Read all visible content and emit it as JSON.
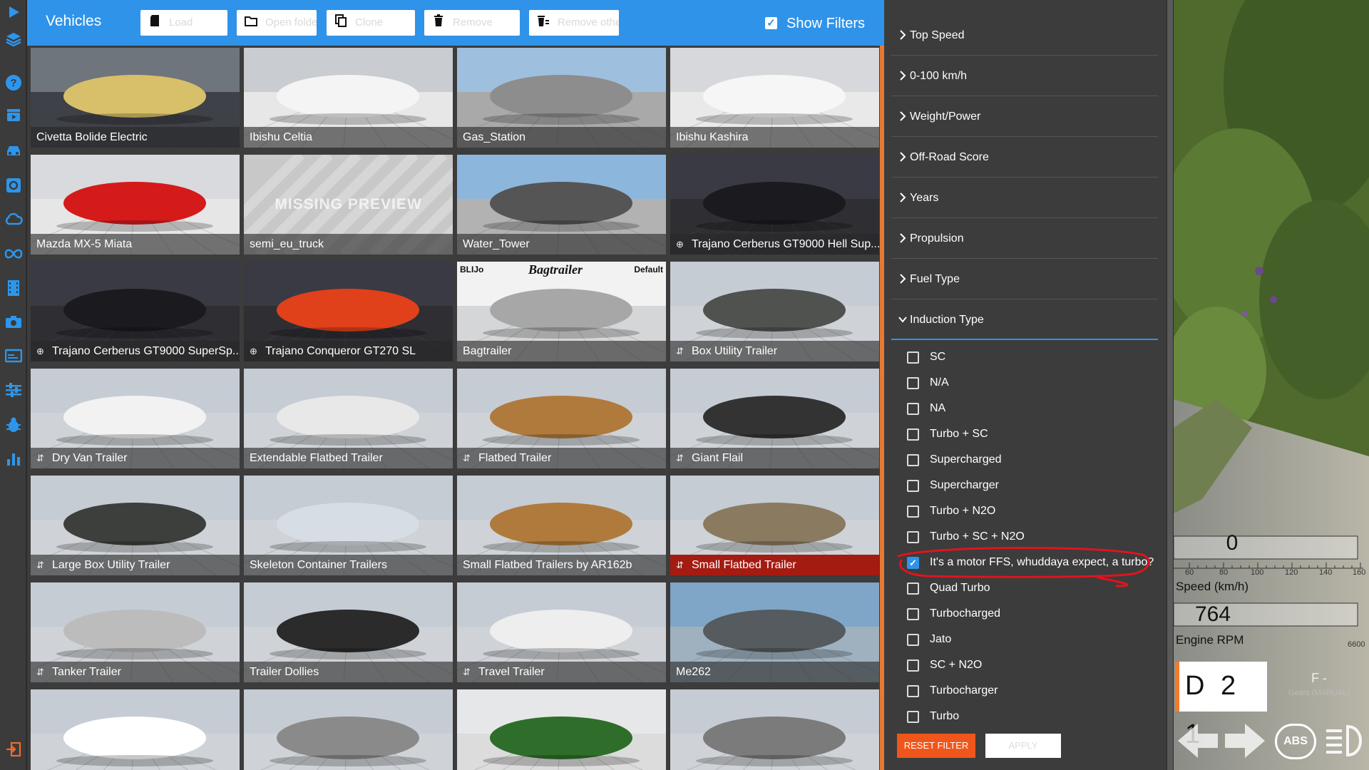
{
  "rail": {
    "icons": [
      "play-icon",
      "layers-icon",
      "help-icon",
      "clapper-icon",
      "car-icon",
      "gear-box-icon",
      "cloud-icon",
      "infinity-icon",
      "film-icon",
      "camera-icon",
      "screen-icon",
      "sliders-icon",
      "bug-icon",
      "bar-chart-icon",
      "exit-icon"
    ]
  },
  "header": {
    "title": "Vehicles",
    "buttons": [
      {
        "label": "Load",
        "icon": "sd-card-icon"
      },
      {
        "label": "Open folder",
        "icon": "folder-icon"
      },
      {
        "label": "Clone",
        "icon": "copy-icon"
      },
      {
        "label": "Remove",
        "icon": "trash-icon"
      },
      {
        "label": "Remove others",
        "icon": "trash-list-icon"
      }
    ],
    "show_filters": {
      "label": "Show Filters",
      "checked": true
    }
  },
  "vehicles": [
    {
      "name": "Civetta Bolide Electric",
      "icon": "",
      "selected": false
    },
    {
      "name": "Ibishu Celtia",
      "icon": "",
      "selected": false
    },
    {
      "name": "Gas_Station",
      "icon": "",
      "selected": false
    },
    {
      "name": "Ibishu Kashira",
      "icon": "",
      "selected": false
    },
    {
      "name": "Mazda MX-5 Miata",
      "icon": "",
      "selected": false
    },
    {
      "name": "semi_eu_truck",
      "icon": "",
      "selected": false,
      "placeholder": "MISSING PREVIEW"
    },
    {
      "name": "Water_Tower",
      "icon": "",
      "selected": false
    },
    {
      "name": "Trajano Cerberus GT9000 Hell Sup...",
      "icon": "mod-icon",
      "selected": false
    },
    {
      "name": "Trajano Cerberus GT9000 SuperSp...",
      "icon": "mod-icon",
      "selected": false
    },
    {
      "name": "Trajano Conqueror GT270 SL",
      "icon": "mod-icon",
      "selected": false
    },
    {
      "name": "Bagtrailer",
      "icon": "",
      "selected": false,
      "banner": {
        "left": "BLIJo",
        "center": "Bagtrailer",
        "right": "Default"
      }
    },
    {
      "name": "Box Utility Trailer",
      "icon": "trailer-icon",
      "selected": false
    },
    {
      "name": "Dry Van Trailer",
      "icon": "trailer-icon",
      "selected": false
    },
    {
      "name": "Extendable Flatbed Trailer",
      "icon": "",
      "selected": false
    },
    {
      "name": "Flatbed Trailer",
      "icon": "trailer-icon",
      "selected": false
    },
    {
      "name": "Giant Flail",
      "icon": "trailer-icon",
      "selected": false
    },
    {
      "name": "Large Box Utility Trailer",
      "icon": "trailer-icon",
      "selected": false
    },
    {
      "name": "Skeleton Container Trailers",
      "icon": "",
      "selected": false
    },
    {
      "name": "Small Flatbed Trailers by AR162b",
      "icon": "",
      "selected": false
    },
    {
      "name": "Small Flatbed Trailer",
      "icon": "trailer-icon",
      "selected": true
    },
    {
      "name": "Tanker Trailer",
      "icon": "trailer-icon",
      "selected": false
    },
    {
      "name": "Trailer Dollies",
      "icon": "",
      "selected": false
    },
    {
      "name": "Travel Trailer",
      "icon": "trailer-icon",
      "selected": false
    },
    {
      "name": "Me262",
      "icon": "",
      "selected": false
    },
    {
      "name": "",
      "icon": "",
      "selected": false
    },
    {
      "name": "",
      "icon": "",
      "selected": false
    },
    {
      "name": "",
      "icon": "",
      "selected": false
    },
    {
      "name": "",
      "icon": "",
      "selected": false
    }
  ],
  "filters": {
    "sections": [
      {
        "label": "Top Speed",
        "open": false
      },
      {
        "label": "0-100 km/h",
        "open": false
      },
      {
        "label": "Weight/Power",
        "open": false
      },
      {
        "label": "Off-Road Score",
        "open": false
      },
      {
        "label": "Years",
        "open": false
      },
      {
        "label": "Propulsion",
        "open": false
      },
      {
        "label": "Fuel Type",
        "open": false
      },
      {
        "label": "Induction Type",
        "open": true
      }
    ],
    "induction_options": [
      {
        "label": "SC",
        "checked": false
      },
      {
        "label": "N/A",
        "checked": false
      },
      {
        "label": "NA",
        "checked": false
      },
      {
        "label": "Turbo + SC",
        "checked": false
      },
      {
        "label": "Supercharged",
        "checked": false
      },
      {
        "label": "Supercharger",
        "checked": false
      },
      {
        "label": "Turbo + N2O",
        "checked": false
      },
      {
        "label": "Turbo + SC + N2O",
        "checked": false
      },
      {
        "label": "It's a motor FFS, whuddaya expect, a turbo?",
        "checked": true
      },
      {
        "label": "Quad Turbo",
        "checked": false
      },
      {
        "label": "Turbocharged",
        "checked": false
      },
      {
        "label": "Jato",
        "checked": false
      },
      {
        "label": "SC + N2O",
        "checked": false
      },
      {
        "label": "Turbocharger",
        "checked": false
      },
      {
        "label": "Turbo",
        "checked": false
      }
    ],
    "reset_label": "RESET FILTER",
    "apply_label": "APPLY"
  },
  "hud": {
    "speed_value": "0",
    "speed_ticks": [
      "60",
      "80",
      "100",
      "120",
      "140",
      "160"
    ],
    "speed_label": "Speed (km/h)",
    "rpm_value": "764",
    "rpm_label": "Engine RPM",
    "rpm_max": "6600",
    "gear_display": "D 2 1",
    "gear_mode": "F -",
    "gear_mode_sub": "Gears (MANUAL)",
    "abs_label": "ABS",
    "icons": [
      "arrow-left-icon",
      "arrow-right-icon",
      "abs-icon",
      "headlight-icon"
    ]
  },
  "colors": {
    "accent_blue": "#2f93ea",
    "accent_orange": "#f0561b",
    "selected_red": "#a41b12",
    "panel_bg": "#3c3c3c",
    "annotation_red": "#e0141e"
  }
}
